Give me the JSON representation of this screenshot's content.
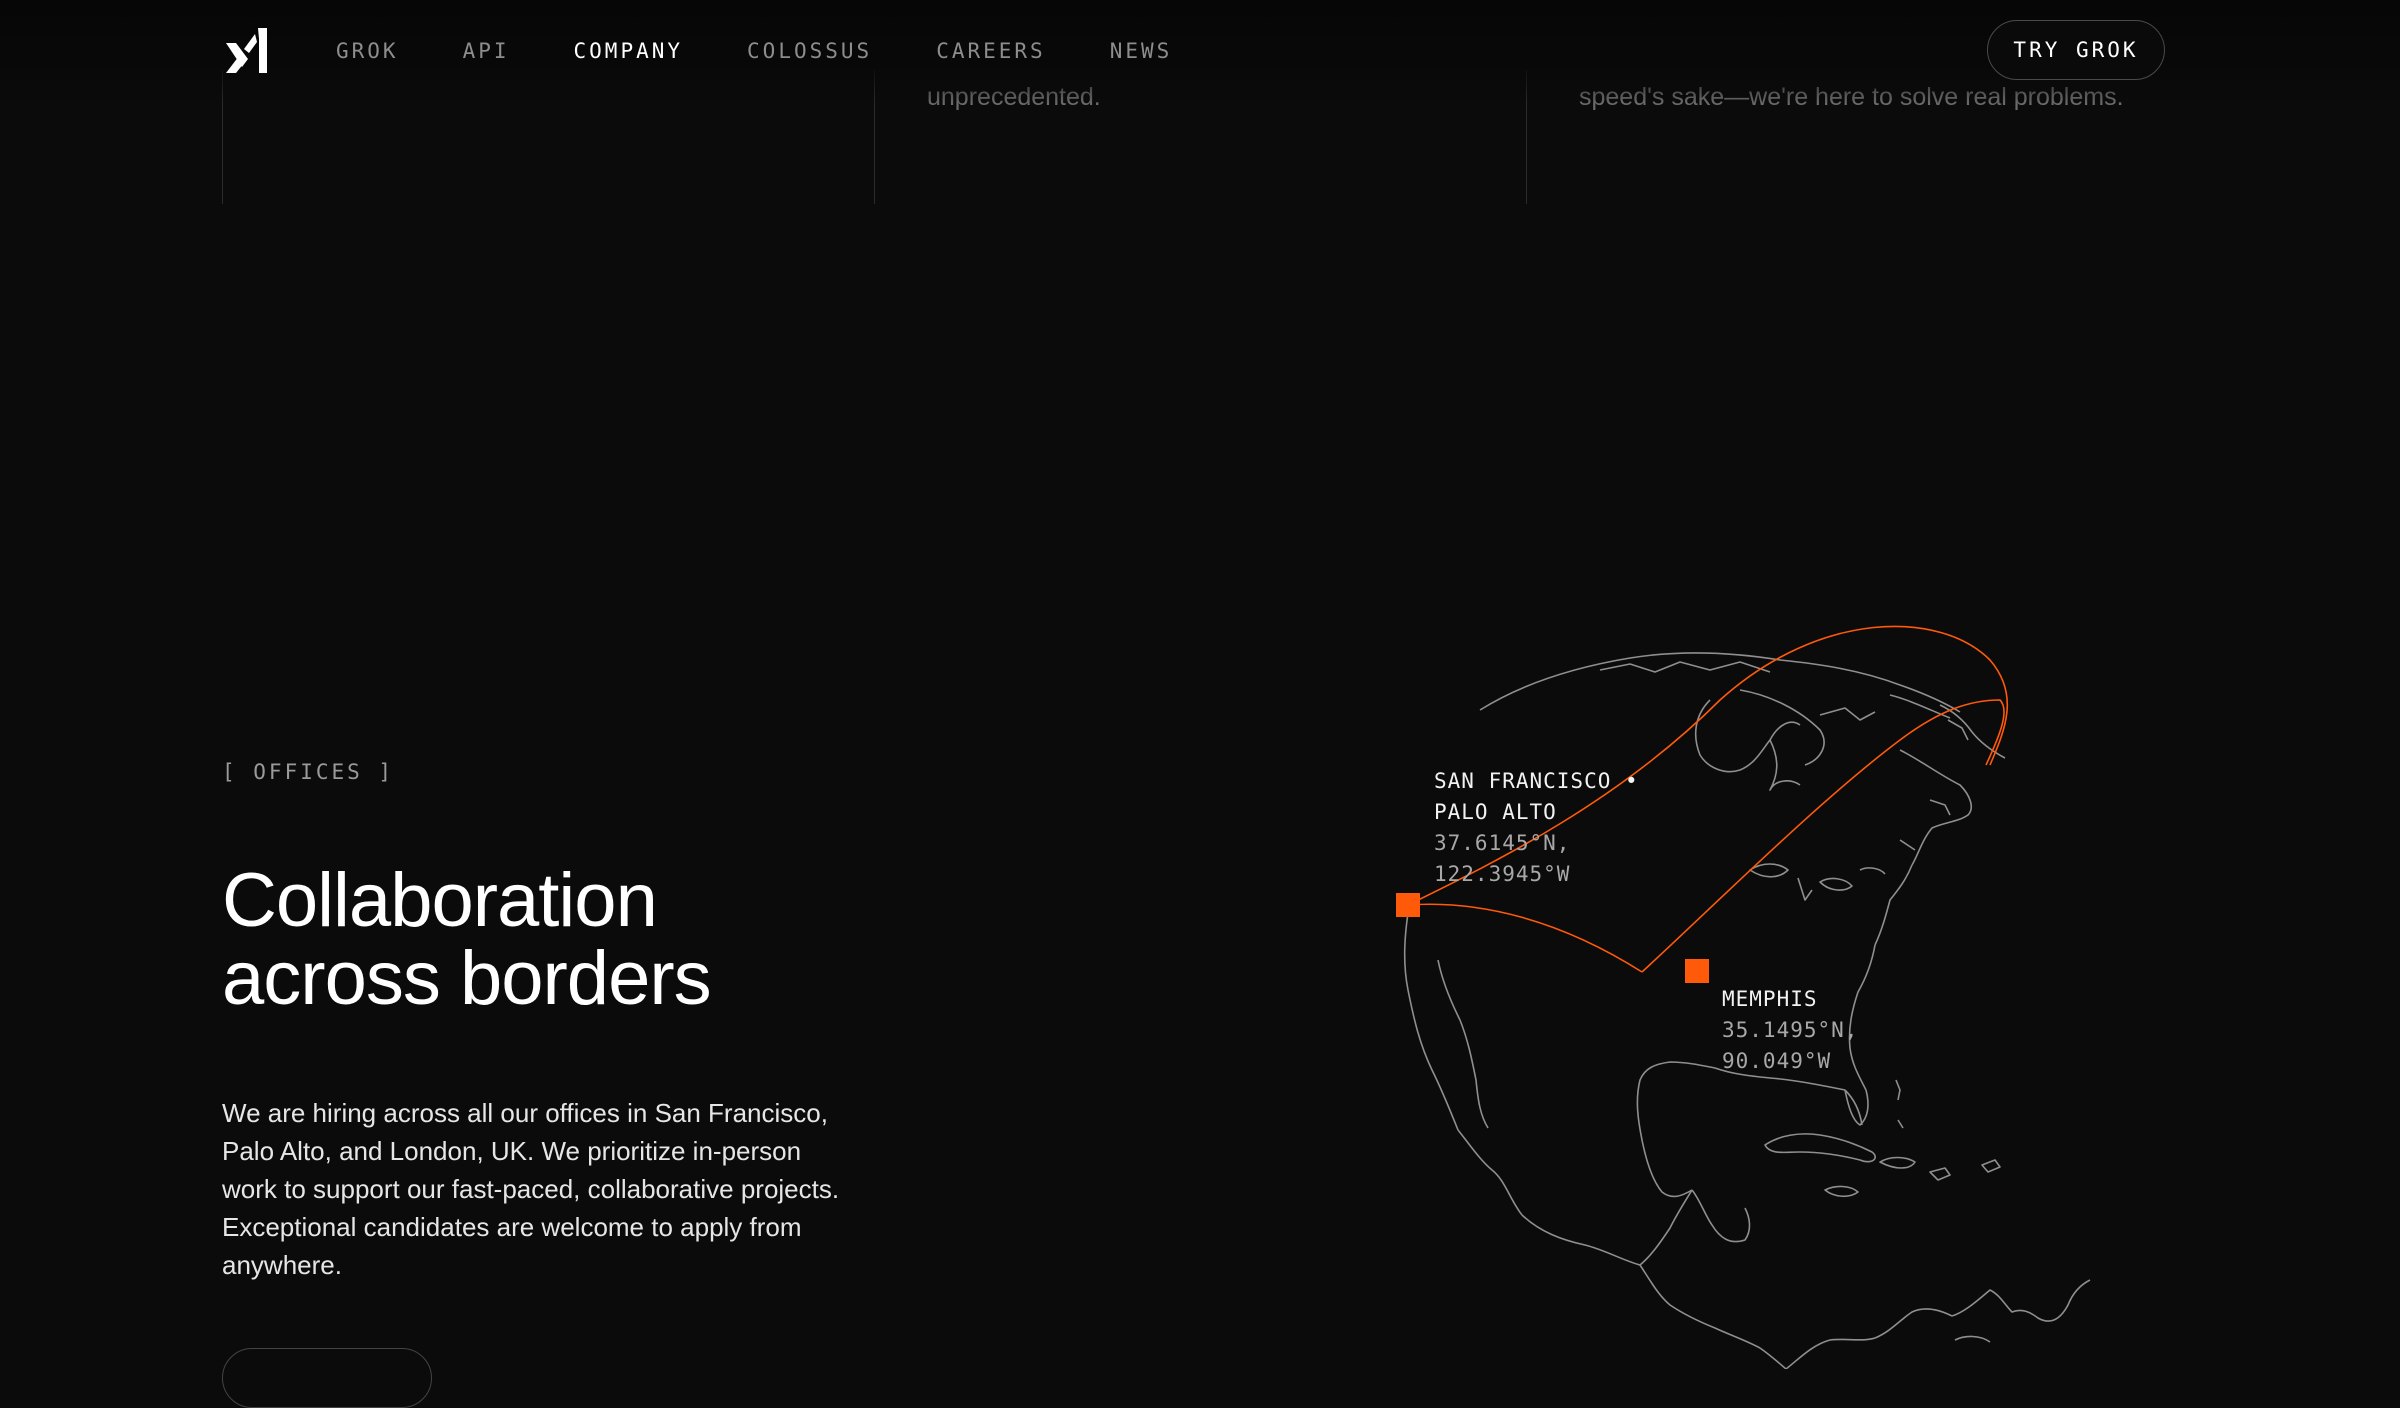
{
  "header": {
    "logo_label": "xAI",
    "nav": [
      {
        "label": "GROK",
        "active": false
      },
      {
        "label": "API",
        "active": false
      },
      {
        "label": "COMPANY",
        "active": true
      },
      {
        "label": "COLOSSUS",
        "active": false
      },
      {
        "label": "CAREERS",
        "active": false
      },
      {
        "label": "NEWS",
        "active": false
      }
    ],
    "cta_label": "TRY GROK"
  },
  "values_strip": {
    "middle_text": "unprecedented.",
    "right_text": "speed's sake—we're here to solve real problems."
  },
  "offices": {
    "eyebrow": "[ OFFICES ]",
    "headline_line1": "Collaboration",
    "headline_line2": "across borders",
    "body": "We are hiring across all our offices in San Francisco, Palo Alto, and London, UK. We prioritize in-person work to support our fast-paced, collaborative projects. Exceptional candidates are welcome to apply from anywhere."
  },
  "map": {
    "accent_color": "#ff5a0a",
    "locations": [
      {
        "city_line1": "SAN FRANCISCO •",
        "city_line2": "PALO ALTO",
        "lat": "37.6145°N,",
        "lon": "122.3945°W"
      },
      {
        "city_line1": "MEMPHIS",
        "lat": "35.1495°N,",
        "lon": "90.049°W"
      }
    ]
  }
}
